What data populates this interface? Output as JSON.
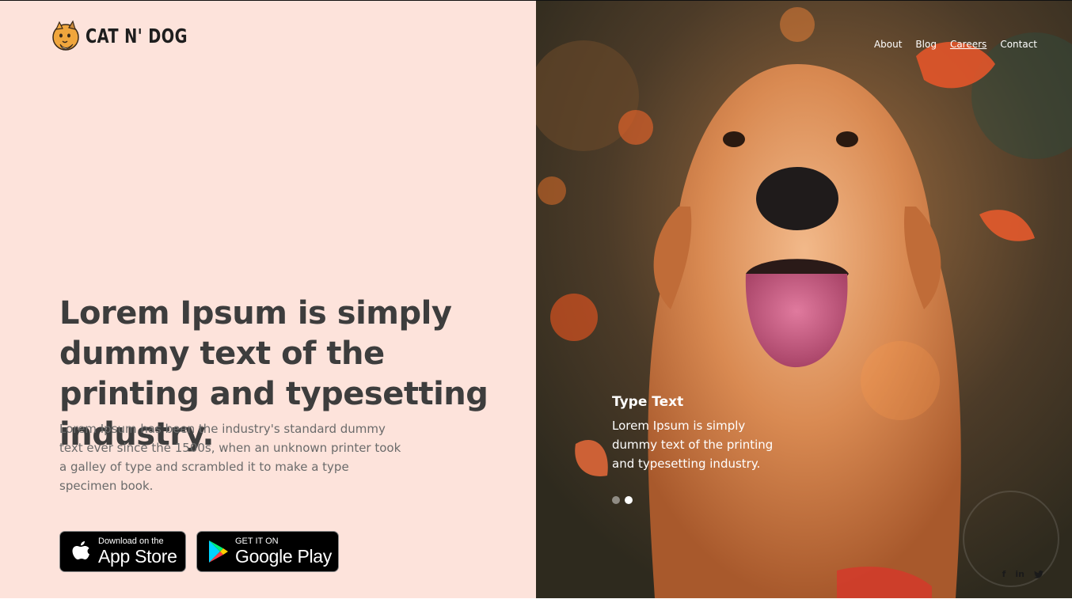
{
  "brand": {
    "name": "CAT N' DOG",
    "logo_icon": "cat-dog-logo-icon"
  },
  "nav": {
    "items": [
      {
        "label": "About"
      },
      {
        "label": "Blog"
      },
      {
        "label": "Careers",
        "active": true
      },
      {
        "label": "Contact"
      }
    ]
  },
  "hero": {
    "headline": "Lorem Ipsum is simply dummy text of the printing and typesetting industry.",
    "subtext": "Lorem Ipsum has been the industry's standard dummy text ever since the 1500s, when an unknown printer took a galley of type and scrambled it to make a type specimen book."
  },
  "store_buttons": {
    "apple": {
      "small": "Download on the",
      "big": "App Store",
      "icon": "apple-icon"
    },
    "google": {
      "small": "GET IT ON",
      "big": "Google Play",
      "icon": "google-play-icon"
    }
  },
  "slide": {
    "title": "Type Text",
    "body": "Lorem Ipsum is simply dummy text of the printing and typesetting industry.",
    "dots": 2,
    "active_dot": 2
  },
  "social": {
    "facebook": "f",
    "linkedin": "in",
    "twitter_icon": "twitter-icon"
  },
  "colors": {
    "left_background": "#fde3db",
    "headline": "#3d3d3d",
    "subtext": "#6b6b6b"
  }
}
